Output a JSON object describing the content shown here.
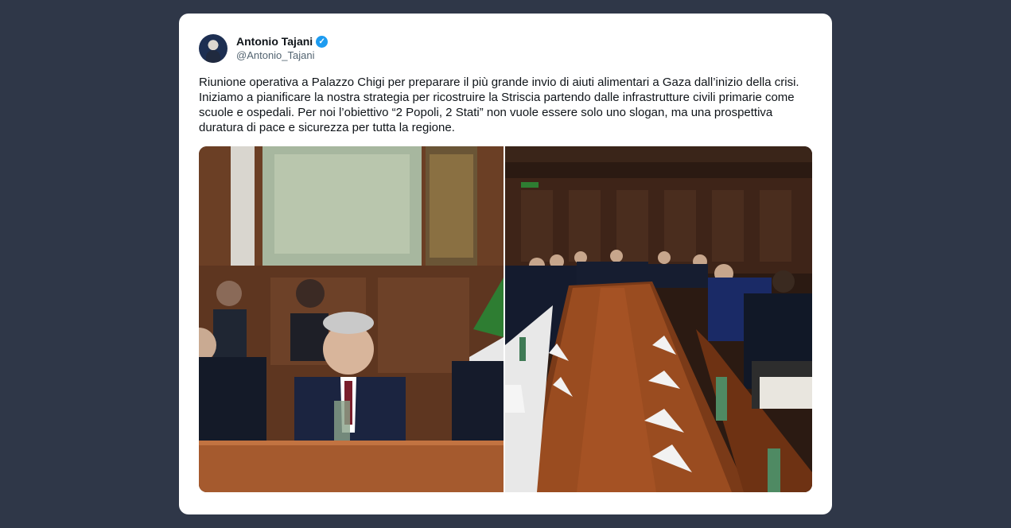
{
  "tweet": {
    "author": {
      "display_name": "Antonio Tajani",
      "handle": "@Antonio_Tajani",
      "verified_icon": "verified-badge-icon",
      "avatar_icon": "profile-avatar"
    },
    "text": "Riunione operativa a Palazzo Chigi per preparare il più grande invio di aiuti alimentari a Gaza dall’inizio della crisi. Iniziamo a pianificare la nostra strategia per ricostruire la Striscia partendo dalle infrastrutture civili primarie come scuole e ospedali. Per noi l’obiettivo “2 Popoli, 2 Stati” non vuole essere solo uno slogan, ma una prospettiva duratura di pace e sicurezza per tutta la regione.",
    "media": [
      {
        "name": "photo-meeting-closeup"
      },
      {
        "name": "photo-meeting-table"
      }
    ]
  },
  "colors": {
    "page_background": "#2f3748",
    "card_background": "#ffffff",
    "verified_blue": "#1d9bf0",
    "text_primary": "#0f1419",
    "text_secondary": "#536471"
  }
}
